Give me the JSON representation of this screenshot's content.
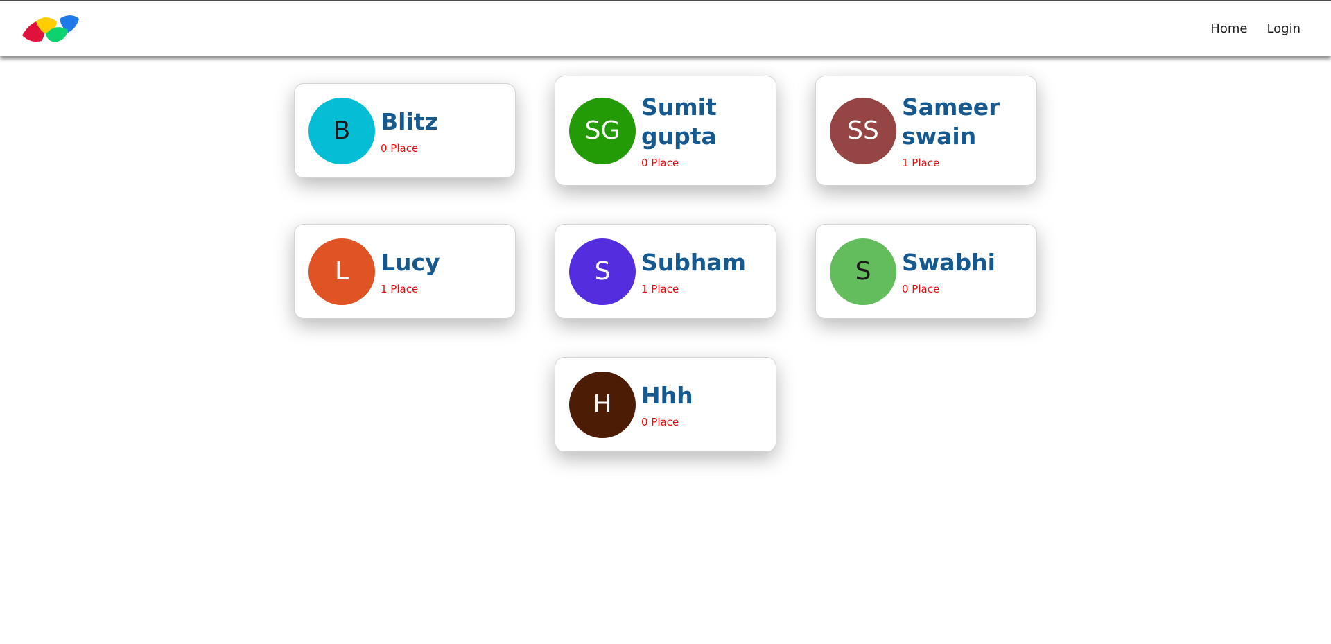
{
  "nav": {
    "logo_icon": "brand-logo-icon",
    "home": "Home",
    "login": "Login"
  },
  "users": [
    {
      "initials": "B",
      "name": "Blitz",
      "places": "0 Place",
      "color": "#05bed6",
      "initials_color": "#1a1a1a"
    },
    {
      "initials": "SG",
      "name": "Sumit gupta",
      "places": "0 Place",
      "color": "#239b06",
      "initials_color": "#ffffff"
    },
    {
      "initials": "SS",
      "name": "Sameer swain",
      "places": "1 Place",
      "color": "#954543",
      "initials_color": "#ffffff"
    },
    {
      "initials": "L",
      "name": "Lucy",
      "places": "1 Place",
      "color": "#e05325",
      "initials_color": "#ffffff"
    },
    {
      "initials": "S",
      "name": "Subham",
      "places": "1 Place",
      "color": "#542ddf",
      "initials_color": "#ffffff"
    },
    {
      "initials": "S",
      "name": "Swabhi",
      "places": "0 Place",
      "color": "#64bd5d",
      "initials_color": "#1a1a1a"
    },
    {
      "initials": "H",
      "name": "Hhh",
      "places": "0 Place",
      "color": "#4c1c04",
      "initials_color": "#ffffff"
    }
  ],
  "colors": {
    "name_text": "#15598f",
    "places_text": "#e80d0d"
  }
}
